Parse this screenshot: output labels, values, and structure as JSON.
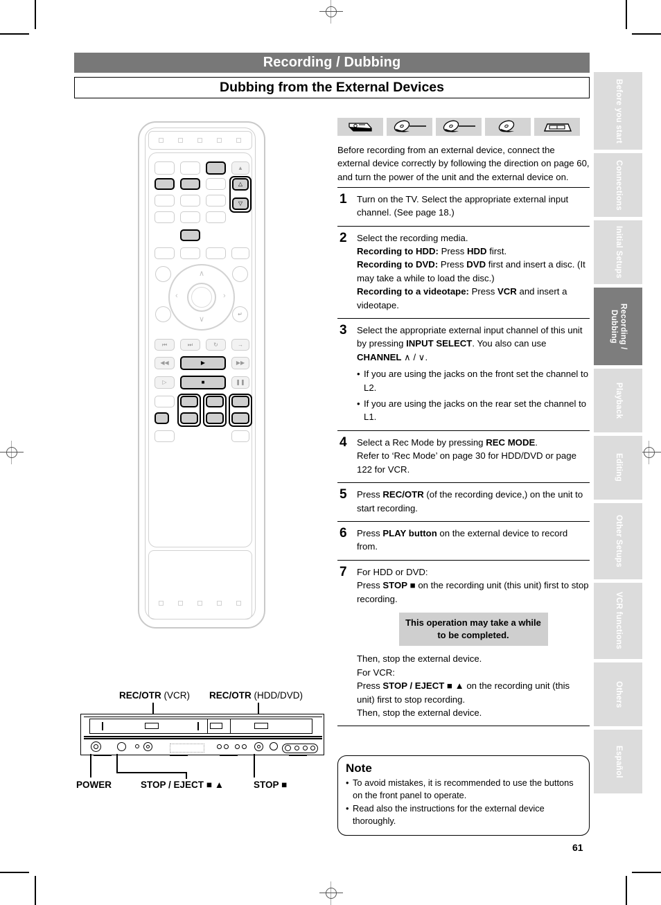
{
  "document": {
    "chapter_title": "Recording / Dubbing",
    "section_title": "Dubbing from the External Devices",
    "page_number": "61"
  },
  "side_tabs": [
    {
      "label": "Before you start",
      "active": false
    },
    {
      "label": "Connections",
      "active": false
    },
    {
      "label": "Initial Setups",
      "active": false
    },
    {
      "label": "Recording / Dubbing",
      "active": true
    },
    {
      "label": "Playback",
      "active": false
    },
    {
      "label": "Editing",
      "active": false
    },
    {
      "label": "Other Setups",
      "active": false
    },
    {
      "label": "VCR functions",
      "active": false
    },
    {
      "label": "Others",
      "active": false
    },
    {
      "label": "Español",
      "active": false
    }
  ],
  "media_icons": [
    {
      "name": "hdd-icon",
      "label": "HDD"
    },
    {
      "name": "dvd-r-disc-icon",
      "label": "DVD-R"
    },
    {
      "name": "dvd-rw-disc-icon",
      "label": "DVD-RW"
    },
    {
      "name": "dvd-ram-disc-icon",
      "label": "DVD-RAM"
    },
    {
      "name": "vhs-tape-icon",
      "label": "VHS"
    }
  ],
  "intro": "Before recording from an external device, connect the external device correctly by following the direction on page 60, and turn the power of the unit and the external device on.",
  "steps": [
    {
      "number": "1",
      "lines": [
        {
          "type": "plain",
          "text": "Turn on the TV.  Select the appropriate external input channel. (See page 18.)"
        }
      ]
    },
    {
      "number": "2",
      "lines": [
        {
          "type": "plain",
          "text": "Select the recording media."
        },
        {
          "type": "rich",
          "parts": [
            {
              "b": true,
              "t": "Recording to HDD:"
            },
            {
              "b": false,
              "t": " Press "
            },
            {
              "b": true,
              "t": "HDD"
            },
            {
              "b": false,
              "t": " first."
            }
          ]
        },
        {
          "type": "rich",
          "parts": [
            {
              "b": true,
              "t": "Recording to DVD:"
            },
            {
              "b": false,
              "t": " Press "
            },
            {
              "b": true,
              "t": "DVD"
            },
            {
              "b": false,
              "t": " first and insert a disc. (It may take a while to load the disc.)"
            }
          ]
        },
        {
          "type": "rich",
          "parts": [
            {
              "b": true,
              "t": "Recording to a videotape:"
            },
            {
              "b": false,
              "t": " Press "
            },
            {
              "b": true,
              "t": "VCR"
            },
            {
              "b": false,
              "t": " and insert a videotape."
            }
          ]
        }
      ]
    },
    {
      "number": "3",
      "lines": [
        {
          "type": "rich",
          "parts": [
            {
              "b": false,
              "t": "Select the appropriate external input channel of this unit by pressing "
            },
            {
              "b": true,
              "t": "INPUT SELECT"
            },
            {
              "b": false,
              "t": ". You also can use "
            },
            {
              "b": true,
              "t": "CHANNEL"
            },
            {
              "b": false,
              "t": " ∧ / ∨."
            }
          ]
        }
      ],
      "bullets": [
        "If you are using the jacks on the front set the channel to L2.",
        "If you are using the jacks on the rear set the channel to L1."
      ]
    },
    {
      "number": "4",
      "lines": [
        {
          "type": "rich",
          "parts": [
            {
              "b": false,
              "t": "Select a Rec Mode by pressing "
            },
            {
              "b": true,
              "t": "REC MODE"
            },
            {
              "b": false,
              "t": "."
            }
          ]
        },
        {
          "type": "plain",
          "text": "Refer to ‘Rec Mode’ on page 30 for HDD/DVD or page 122 for VCR."
        }
      ]
    },
    {
      "number": "5",
      "lines": [
        {
          "type": "rich",
          "parts": [
            {
              "b": false,
              "t": "Press "
            },
            {
              "b": true,
              "t": "REC/OTR"
            },
            {
              "b": false,
              "t": " (of the recording device,) on the unit to start recording."
            }
          ]
        }
      ]
    },
    {
      "number": "6",
      "lines": [
        {
          "type": "rich",
          "parts": [
            {
              "b": false,
              "t": "Press "
            },
            {
              "b": true,
              "t": "PLAY button"
            },
            {
              "b": false,
              "t": " on the external device to record from."
            }
          ]
        }
      ]
    },
    {
      "number": "7",
      "lines": [
        {
          "type": "plain",
          "text": "For HDD or DVD:"
        },
        {
          "type": "rich",
          "parts": [
            {
              "b": false,
              "t": "Press "
            },
            {
              "b": true,
              "t": "STOP"
            },
            {
              "b": false,
              "t": " ■ on the recording unit (this unit) first to stop recording."
            }
          ]
        }
      ],
      "callout": "This operation may take a while to be completed.",
      "after": [
        {
          "type": "plain",
          "text": "Then, stop the external device."
        },
        {
          "type": "plain",
          "text": "For VCR:"
        },
        {
          "type": "rich",
          "parts": [
            {
              "b": false,
              "t": "Press "
            },
            {
              "b": true,
              "t": "STOP / EJECT"
            },
            {
              "b": false,
              "t": " ■ ▲ on the recording unit (this unit) first to stop recording."
            }
          ]
        },
        {
          "type": "plain",
          "text": "Then, stop the external device."
        }
      ]
    }
  ],
  "note": {
    "title": "Note",
    "items": [
      "To avoid mistakes, it is recommended to use the buttons on the front panel to operate.",
      "Read also the instructions for the external device thoroughly."
    ]
  },
  "front_panel": {
    "top_labels": [
      {
        "bold": "REC/OTR",
        "plain": " (VCR)"
      },
      {
        "bold": "REC/OTR",
        "plain": " (HDD/DVD)"
      }
    ],
    "bottom_labels": [
      {
        "bold": "POWER",
        "plain": ""
      },
      {
        "bold": "STOP / EJECT",
        "plain": " ■ ▲"
      },
      {
        "bold": "STOP",
        "plain": " ■"
      }
    ]
  },
  "remote": {
    "caption": "remote control illustration with highlighted buttons"
  },
  "colors": {
    "chapter_bar": "#787878",
    "tab_inactive": "#dcdcdc",
    "tab_active": "#7d7d7d",
    "callout_bg": "#cfcfcf",
    "media_icon_bg": "#d4d4d4"
  }
}
